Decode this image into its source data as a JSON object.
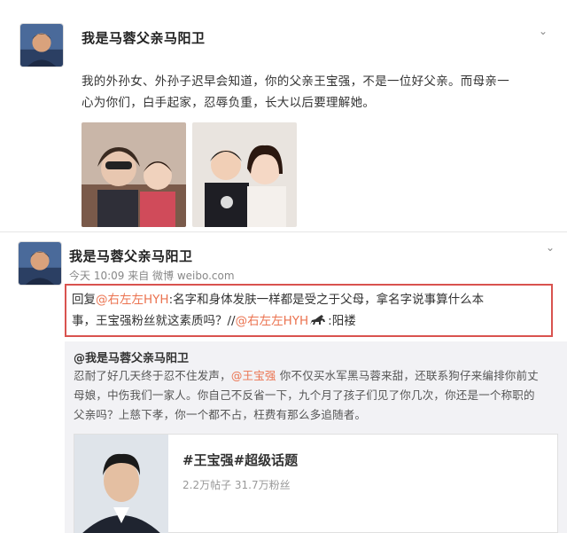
{
  "post1": {
    "username": "我是马蓉父亲马阳卫",
    "text_line1": "我的外孙女、外孙子迟早会知道，你的父亲王宝强，不是一位好父亲。而母亲一",
    "text_line2": "心为你们，白手起家，忍辱负重，长大以后要理解她。",
    "avatar_icon": "avatar-man-icon",
    "photo_icons": [
      "family-selfie-photo",
      "mother-son-photo"
    ]
  },
  "post2": {
    "username": "我是马蓉父亲马阳卫",
    "meta": "今天 10:09 来自 微博 weibo.com",
    "reply": {
      "prefix": "回复",
      "mention1": "@右左左HYH",
      "line1_rest": ":名字和身体发肤一样都是受之于父母，拿名字说事算什么本",
      "line2_start": "事，王宝强粉丝就这素质吗？//",
      "mention2": "@右左左HYH",
      "line2_end": ":阳褛"
    },
    "repost": {
      "username": "@我是马蓉父亲马阳卫",
      "line1_start": "忍耐了好几天终于忍不住发声，",
      "mention": "@王宝强",
      "line1_end": " 你不仅买水军黑马蓉来甜，还联系狗仔来编排你前丈",
      "line2": "母娘，中伤我们一家人。你自己不反省一下，九个月了孩子们见了你几次，你还是一个称职的",
      "line3": "父亲吗？上慈下孝，你一个都不占，枉费有那么多追随者。"
    },
    "topic": {
      "title": "#王宝强#超级话题",
      "stats": "2.2万帖子 31.7万粉丝",
      "photo_icon": "man-portrait-photo"
    }
  },
  "colors": {
    "mention": "#eb7350",
    "highlight_border": "#d9534f",
    "repost_bg": "#f2f2f5"
  }
}
